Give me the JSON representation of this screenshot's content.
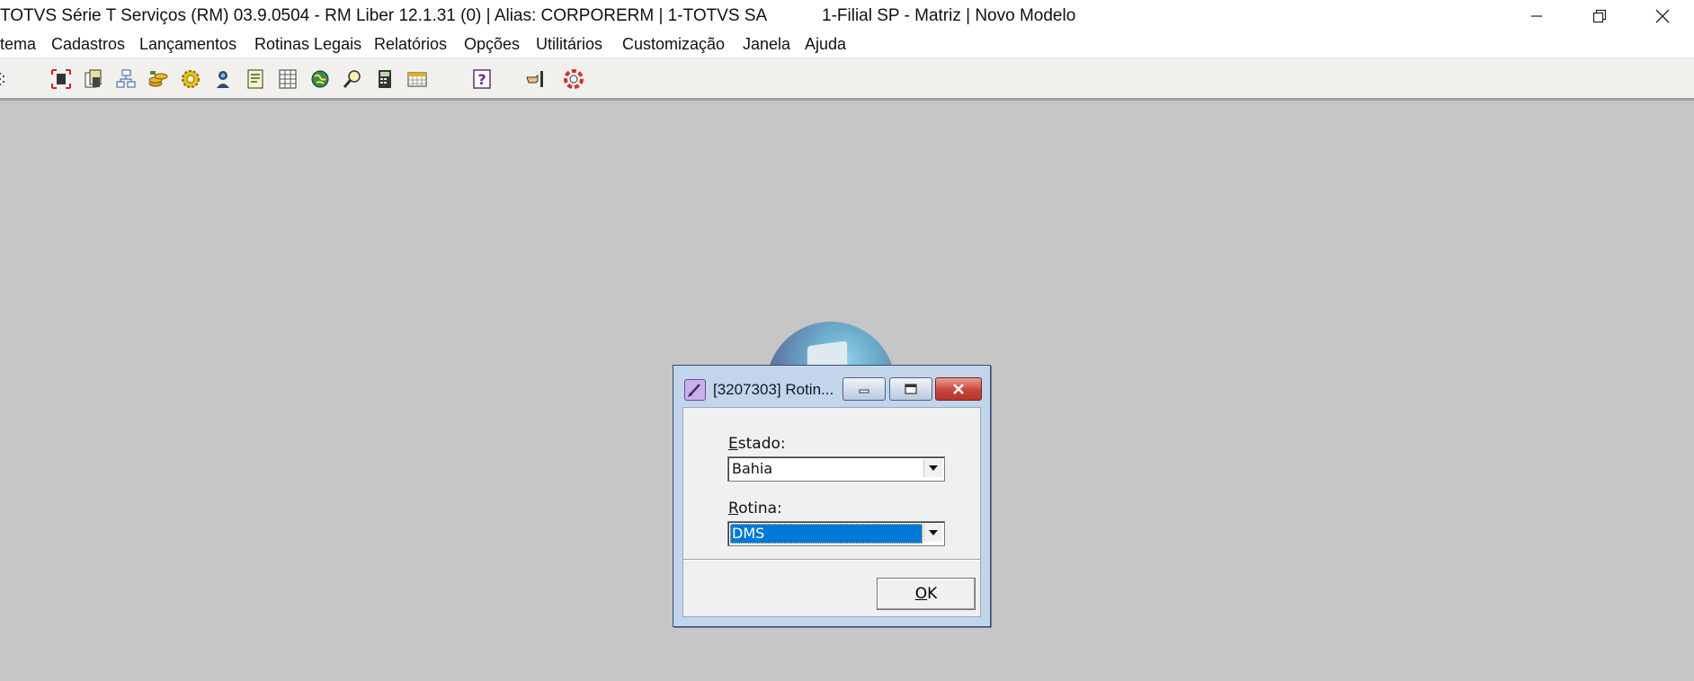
{
  "window": {
    "title_left": "TOTVS Série T Serviços (RM) 03.9.0504 - RM Liber 12.1.31 (0) | Alias: CORPORERM | 1-TOTVS SA",
    "title_right": "1-Filial SP - Matriz | Novo Modelo",
    "controls": {
      "minimize": "—",
      "restore": "❐",
      "close": "✕"
    }
  },
  "menu": {
    "items": [
      "tema",
      "Cadastros",
      "Lançamentos",
      "Rotinas Legais",
      "Relatórios",
      "Opções",
      "Utilitários",
      "Customização",
      "Janela",
      "Ajuda"
    ]
  },
  "toolbar": {
    "icons": [
      "grip-icon",
      "resize-icon",
      "document-stack-icon",
      "org-chart-icon",
      "coins-icon",
      "settings-gear-icon",
      "person-icon",
      "report-icon",
      "table-icon",
      "globe-icon",
      "search-doc-icon",
      "calculator-icon",
      "calendar-icon",
      "help-icon",
      "pointer-icon",
      "lifebuoy-icon"
    ]
  },
  "dialog": {
    "title": "[3207303]  Rotin...",
    "estado": {
      "label_first": "E",
      "label_rest": "stado:",
      "value": "Bahia"
    },
    "rotina": {
      "label_first": "R",
      "label_rest": "otina:",
      "value": "DMS"
    },
    "ok": {
      "label_first": "O",
      "label_rest": "K"
    }
  },
  "colors": {
    "workspace": "#c6c6c6",
    "selection": "#0078d7",
    "dialog_frame": "#c2d5ea",
    "close_red": "#c8453a"
  }
}
